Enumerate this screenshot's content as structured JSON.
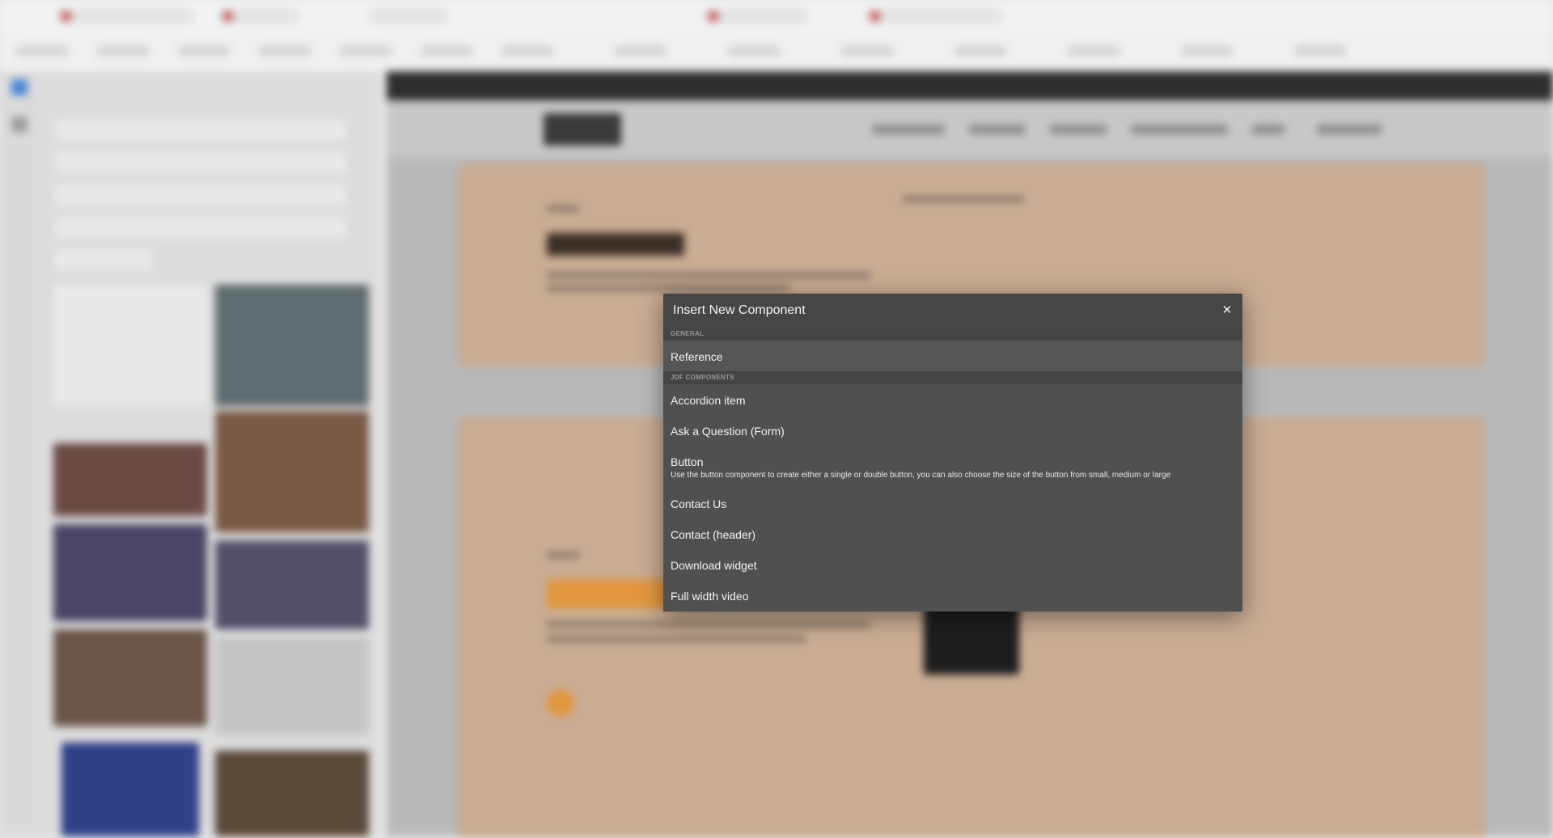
{
  "modal": {
    "title": "Insert New Component",
    "close_icon": "close-icon",
    "close_glyph": "✕",
    "groups": [
      {
        "label": "GENERAL",
        "items": [
          {
            "title": "Reference"
          }
        ]
      },
      {
        "label": "JDF COMPONENTS",
        "items": [
          {
            "title": "Accordion item"
          },
          {
            "title": "Ask a Question (Form)"
          },
          {
            "title": "Button",
            "description": "Use the button component to create either a single or double button, you can also choose the size of the button from small, medium or large"
          },
          {
            "title": "Contact Us"
          },
          {
            "title": "Contact (header)"
          },
          {
            "title": "Download widget"
          },
          {
            "title": "Full width video"
          }
        ]
      }
    ]
  }
}
